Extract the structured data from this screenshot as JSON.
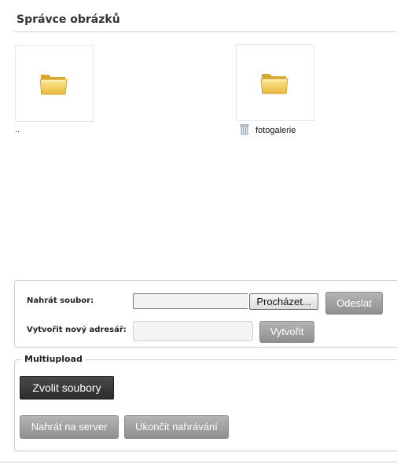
{
  "header": {
    "title": "Správce obrázků"
  },
  "files": [
    {
      "name": "..",
      "icon": "folder-icon",
      "has_delete": false
    },
    {
      "name": "fotogalerie",
      "icon": "folder-icon",
      "has_delete": true
    }
  ],
  "upload": {
    "upload_label": "Nahrát soubor:",
    "browse_label": "Procházet...",
    "send_label": "Odeslat",
    "mkdir_label": "Vytvořit nový adresář:",
    "mkdir_value": "",
    "create_label": "Vytvořit"
  },
  "multiupload": {
    "legend": "Multiupload",
    "choose_label": "Zvolit soubory",
    "upload_server_label": "Nahrát na server",
    "stop_label": "Ukončit nahrávání"
  },
  "colors": {
    "folder": "#f2c84b",
    "button_gray": "#9e9e9e",
    "button_dark": "#333333"
  }
}
